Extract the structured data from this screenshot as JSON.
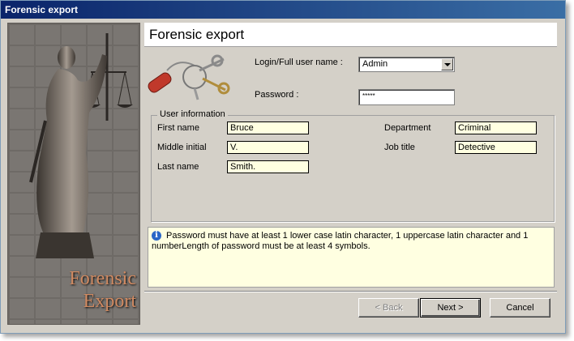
{
  "window": {
    "title": "Forensic export"
  },
  "side_panel": {
    "brand_line1": "Forensic",
    "brand_line2": "Export"
  },
  "header": {
    "title": "Forensic export"
  },
  "login": {
    "login_label": "Login/Full user name :",
    "login_value": "Admin",
    "password_label": "Password :",
    "password_value": "*****"
  },
  "user_info": {
    "legend": "User information",
    "first_name_label": "First name",
    "first_name": "Bruce",
    "middle_initial_label": "Middle initial",
    "middle_initial": "V.",
    "last_name_label": "Last name",
    "last_name": "Smith.",
    "department_label": "Department",
    "department": "Criminal",
    "job_title_label": "Job title",
    "job_title": "Detective"
  },
  "info": {
    "message": "Password must have at least 1 lower case latin character, 1 uppercase latin character and 1 numberLength of password must be at least 4 symbols."
  },
  "buttons": {
    "back": "< Back",
    "next": "Next >",
    "cancel": "Cancel"
  }
}
